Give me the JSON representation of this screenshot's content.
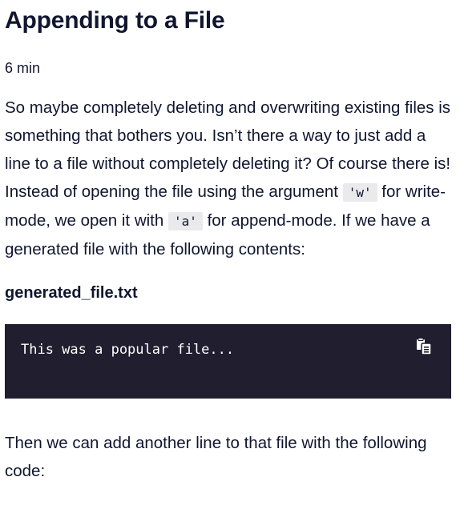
{
  "lesson": {
    "title": "Appending to a File",
    "duration": "6 min"
  },
  "intro": {
    "part1": "So maybe completely deleting and overwriting existing files is something that bothers you. Isn’t there a way to just add a line to a file without completely deleting it? Of course there is! Instead of opening the file using the argument ",
    "code_w": "'w'",
    "part2": " for write-mode, we open it with ",
    "code_a": "'a'",
    "part3": " for append-mode. If we have a generated file with the following contents:"
  },
  "file": {
    "name": "generated_file.txt",
    "contents": "This was a popular file..."
  },
  "copy_icon": "copy-icon",
  "followup": {
    "text": "Then we can add another line to that file with the following code:"
  },
  "colors": {
    "text": "#10162f",
    "code_bg": "#211e2f",
    "inline_code_bg": "#eaeaed"
  }
}
